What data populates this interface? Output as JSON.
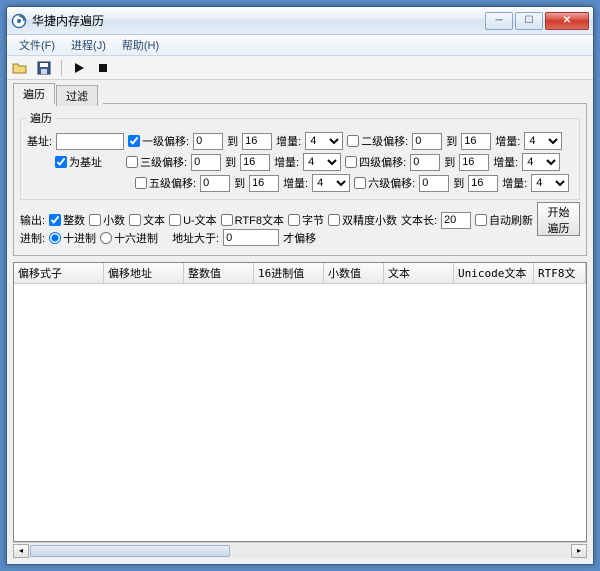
{
  "window": {
    "title": "华捷内存遍历"
  },
  "menu": {
    "file": "文件(F)",
    "process": "进程(J)",
    "help": "帮助(H)"
  },
  "tabs": {
    "traverse": "遍历",
    "filter": "过滤"
  },
  "group": {
    "legend": "遍历"
  },
  "labels": {
    "base_addr": "基址:",
    "as_base": "为基址",
    "offset1": "一级偏移:",
    "offset2": "二级偏移:",
    "offset3": "三级偏移:",
    "offset4": "四级偏移:",
    "offset5": "五级偏移:",
    "offset6": "六级偏移:",
    "to": "到",
    "inc": "增量:",
    "output": "输出:",
    "out_int": "整数",
    "out_dec": "小数",
    "out_text": "文本",
    "out_utext": "U-文本",
    "out_rtf8": "RTF8文本",
    "out_byte": "字节",
    "out_double": "双精度小数",
    "text_len": "文本长:",
    "auto_refresh": "自动刷新",
    "radix": "进制:",
    "radix_dec": "十进制",
    "radix_hex": "十六进制",
    "addr_gt": "地址大于:",
    "then_offset": "才偏移",
    "start": "开始遍历"
  },
  "values": {
    "base_addr": "",
    "o1_from": "0",
    "o1_to": "16",
    "o1_inc": "4",
    "o2_from": "0",
    "o2_to": "16",
    "o2_inc": "4",
    "o3_from": "0",
    "o3_to": "16",
    "o3_inc": "4",
    "o4_from": "0",
    "o4_to": "16",
    "o4_inc": "4",
    "o5_from": "0",
    "o5_to": "16",
    "o5_inc": "4",
    "o6_from": "0",
    "o6_to": "16",
    "o6_inc": "4",
    "text_len": "20",
    "addr_gt": "0",
    "cb_offset1": true,
    "cb_as_base": true,
    "cb_out_int": true,
    "radix_dec": true
  },
  "columns": {
    "c0": "偏移式子",
    "c1": "偏移地址",
    "c2": "整数值",
    "c3": "16进制值",
    "c4": "小数值",
    "c5": "文本",
    "c6": "Unicode文本",
    "c7": "RTF8文"
  }
}
